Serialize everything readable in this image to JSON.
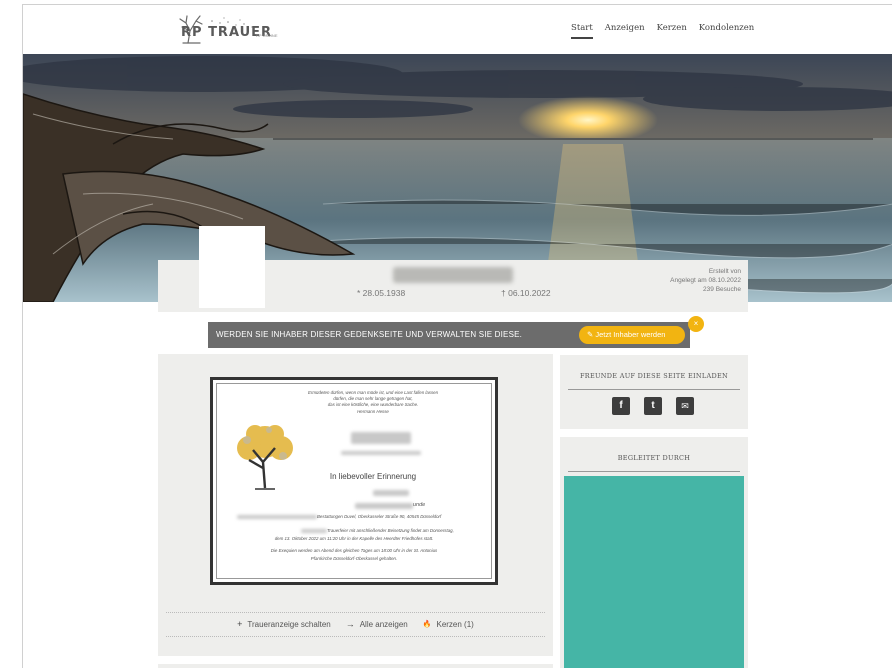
{
  "header": {
    "logo_text": "RP TRAUER",
    "logo_sub": "RP ONLINE"
  },
  "nav": {
    "items": [
      {
        "label": "Start",
        "active": true
      },
      {
        "label": "Anzeigen",
        "active": false
      },
      {
        "label": "Kerzen",
        "active": false
      },
      {
        "label": "Kondolenzen",
        "active": false
      }
    ]
  },
  "profile": {
    "born": "* 28.05.1938",
    "died": "† 06.10.2022",
    "meta": {
      "created_by": "Erstellt von",
      "created_on": "Angelegt am 08.10.2022",
      "visits": "239 Besuche"
    }
  },
  "owner_banner": {
    "text": "WERDEN SIE INHABER DIESER GEDENKSEITE UND VERWALTEN SIE DIESE.",
    "button": "Jetzt Inhaber werden",
    "close": "×"
  },
  "notice": {
    "poem": [
      "Ermüdeten dürfen, wenn man müde ist, und eine Last fallen lassen",
      "dürfen, die man sehr lange getragen hat,",
      "das ist eine köstliche, eine wunderbare Sache.",
      "Hermann Hesse"
    ],
    "memory": "In liebevoller Erinnerung",
    "family_suffix": "unde",
    "arrangements": "Bestattungen Duvel, Oberkasseler Straße 90, 40545 Düsseldorf",
    "service_1": "Trauerfeier mit anschließender Beisetzung findet am Donnerstag,",
    "service_2": "dem 13. Oktober 2022 um 11:20 Uhr in der Kapelle des Heerdter Friedhofes statt.",
    "service_3": "Die Exequien werden am Abend des gleichen Tages um 18:00 Uhr in der St. Antonius",
    "service_4": "Pfarrkirche Düsseldorf-Oberkassel gehalten."
  },
  "card_actions": [
    {
      "icon": "+",
      "label": "Traueranzeige schalten"
    },
    {
      "icon": "→",
      "label": "Alle anzeigen"
    },
    {
      "icon": "🔥",
      "label": "Kerzen (1)"
    }
  ],
  "invite": {
    "title": "FREUNDE AUF DIESE SEITE EINLADEN",
    "facebook": "f",
    "twitter": "t",
    "email": "✉"
  },
  "sponsor": {
    "title": "BEGLEITET DURCH"
  },
  "colors": {
    "accent": "#f2b411",
    "sponsor": "#45b5a6",
    "banner": "#6c6c6c"
  }
}
